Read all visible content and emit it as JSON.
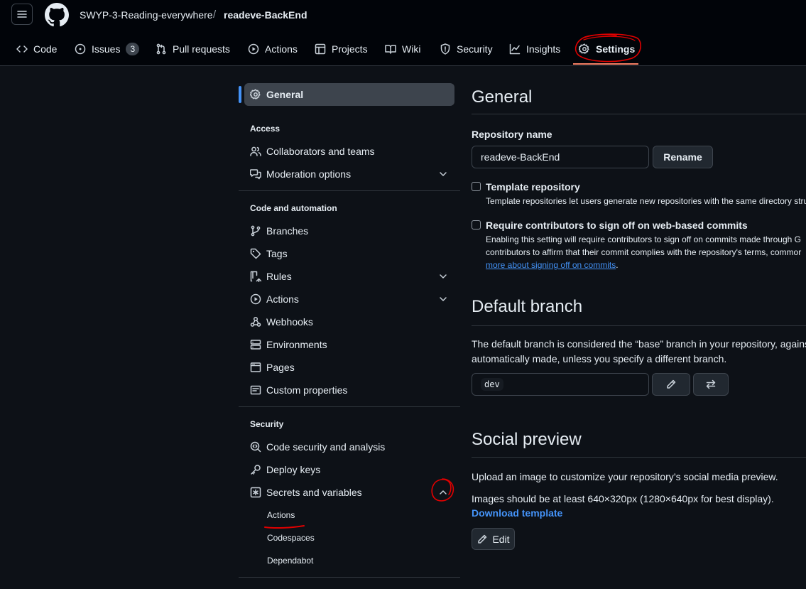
{
  "header": {
    "owner": "SWYP-3-Reading-everywhere",
    "separator": "/",
    "repo": "readeve-BackEnd"
  },
  "tabs": [
    {
      "label": "Code",
      "icon": "code-icon"
    },
    {
      "label": "Issues",
      "icon": "issue-opened-icon",
      "count": "3"
    },
    {
      "label": "Pull requests",
      "icon": "git-pull-request-icon"
    },
    {
      "label": "Actions",
      "icon": "play-icon"
    },
    {
      "label": "Projects",
      "icon": "table-icon"
    },
    {
      "label": "Wiki",
      "icon": "book-icon"
    },
    {
      "label": "Security",
      "icon": "shield-icon"
    },
    {
      "label": "Insights",
      "icon": "graph-icon"
    },
    {
      "label": "Settings",
      "icon": "gear-icon",
      "selected": true
    }
  ],
  "sidebar": {
    "general": "General",
    "access_heading": "Access",
    "access_items": [
      "Collaborators and teams",
      "Moderation options"
    ],
    "code_heading": "Code and automation",
    "code_items": [
      "Branches",
      "Tags",
      "Rules",
      "Actions",
      "Webhooks",
      "Environments",
      "Pages",
      "Custom properties"
    ],
    "security_heading": "Security",
    "security_items": [
      "Code security and analysis",
      "Deploy keys",
      "Secrets and variables"
    ],
    "secrets_sub": [
      "Actions",
      "Codespaces",
      "Dependabot"
    ]
  },
  "main": {
    "title": "General",
    "repo_name_label": "Repository name",
    "repo_name_value": "readeve-BackEnd",
    "rename_button": "Rename",
    "template_label": "Template repository",
    "template_note": "Template repositories let users generate new repositories with the same directory stru",
    "signoff_label": "Require contributors to sign off on web-based commits",
    "signoff_note_1": "Enabling this setting will require contributors to sign off on commits made through G",
    "signoff_note_2": "contributors to affirm that their commit complies with the repository's terms, commor",
    "signoff_link": "more about signing off on commits",
    "signoff_link_tail": ".",
    "default_branch_title": "Default branch",
    "default_branch_text_1": "The default branch is considered the “base” branch in your repository, agains",
    "default_branch_text_2": "automatically made, unless you specify a different branch.",
    "branch_value": "dev",
    "social_title": "Social preview",
    "social_text_1": "Upload an image to customize your repository’s social media preview.",
    "social_text_2": "Images should be at least 640×320px (1280×640px for best display).",
    "download_template": "Download template",
    "edit_button": "Edit"
  },
  "colors": {
    "background": "#0d1117",
    "header_bg": "#010409",
    "accent_blue": "#4493f8",
    "tab_underline": "#f78166",
    "annotation_red": "#e00000"
  }
}
